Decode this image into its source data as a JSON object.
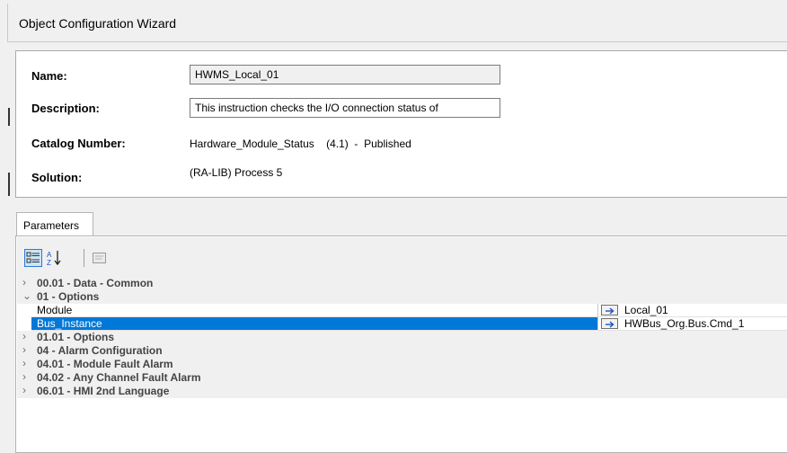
{
  "window": {
    "title": "Object Configuration Wizard"
  },
  "info": {
    "name_label": "Name:",
    "name_value": "HWMS_Local_01",
    "description_label": "Description:",
    "description_value": "This instruction checks the I/O connection status of",
    "catalog_label": "Catalog Number:",
    "catalog_value": "Hardware_Module_Status    (4.1)  -  Published",
    "solution_label": "Solution:",
    "solution_value": "(RA-LIB) Process 5"
  },
  "tabs": [
    {
      "label": "Parameters"
    }
  ],
  "toolbar": {
    "categorized_icon": "categorized-view-icon",
    "alphabetical_icon": "sort-alphabetical-icon",
    "property_pages_icon": "property-pages-icon"
  },
  "grid": {
    "categories": [
      {
        "label": "00.01 - Data - Common",
        "expanded": false
      },
      {
        "label": "01 - Options",
        "expanded": true
      },
      {
        "label": "01.01 - Options",
        "expanded": false
      },
      {
        "label": "04 - Alarm Configuration",
        "expanded": false
      },
      {
        "label": "04.01 - Module Fault Alarm",
        "expanded": false
      },
      {
        "label": "04.02 - Any Channel Fault Alarm",
        "expanded": false
      },
      {
        "label": "06.01 - HMI 2nd Language",
        "expanded": false
      }
    ],
    "properties": [
      {
        "name": "Module",
        "value": "Local_01",
        "selected": false
      },
      {
        "name": "Bus_Instance",
        "value": "HWBus_Org.Bus.Cmd_1",
        "selected": true
      }
    ]
  },
  "colors": {
    "selection": "#0078d7",
    "link_arrow": "#1f4fbf",
    "categorized_button": "#cce4f7"
  }
}
